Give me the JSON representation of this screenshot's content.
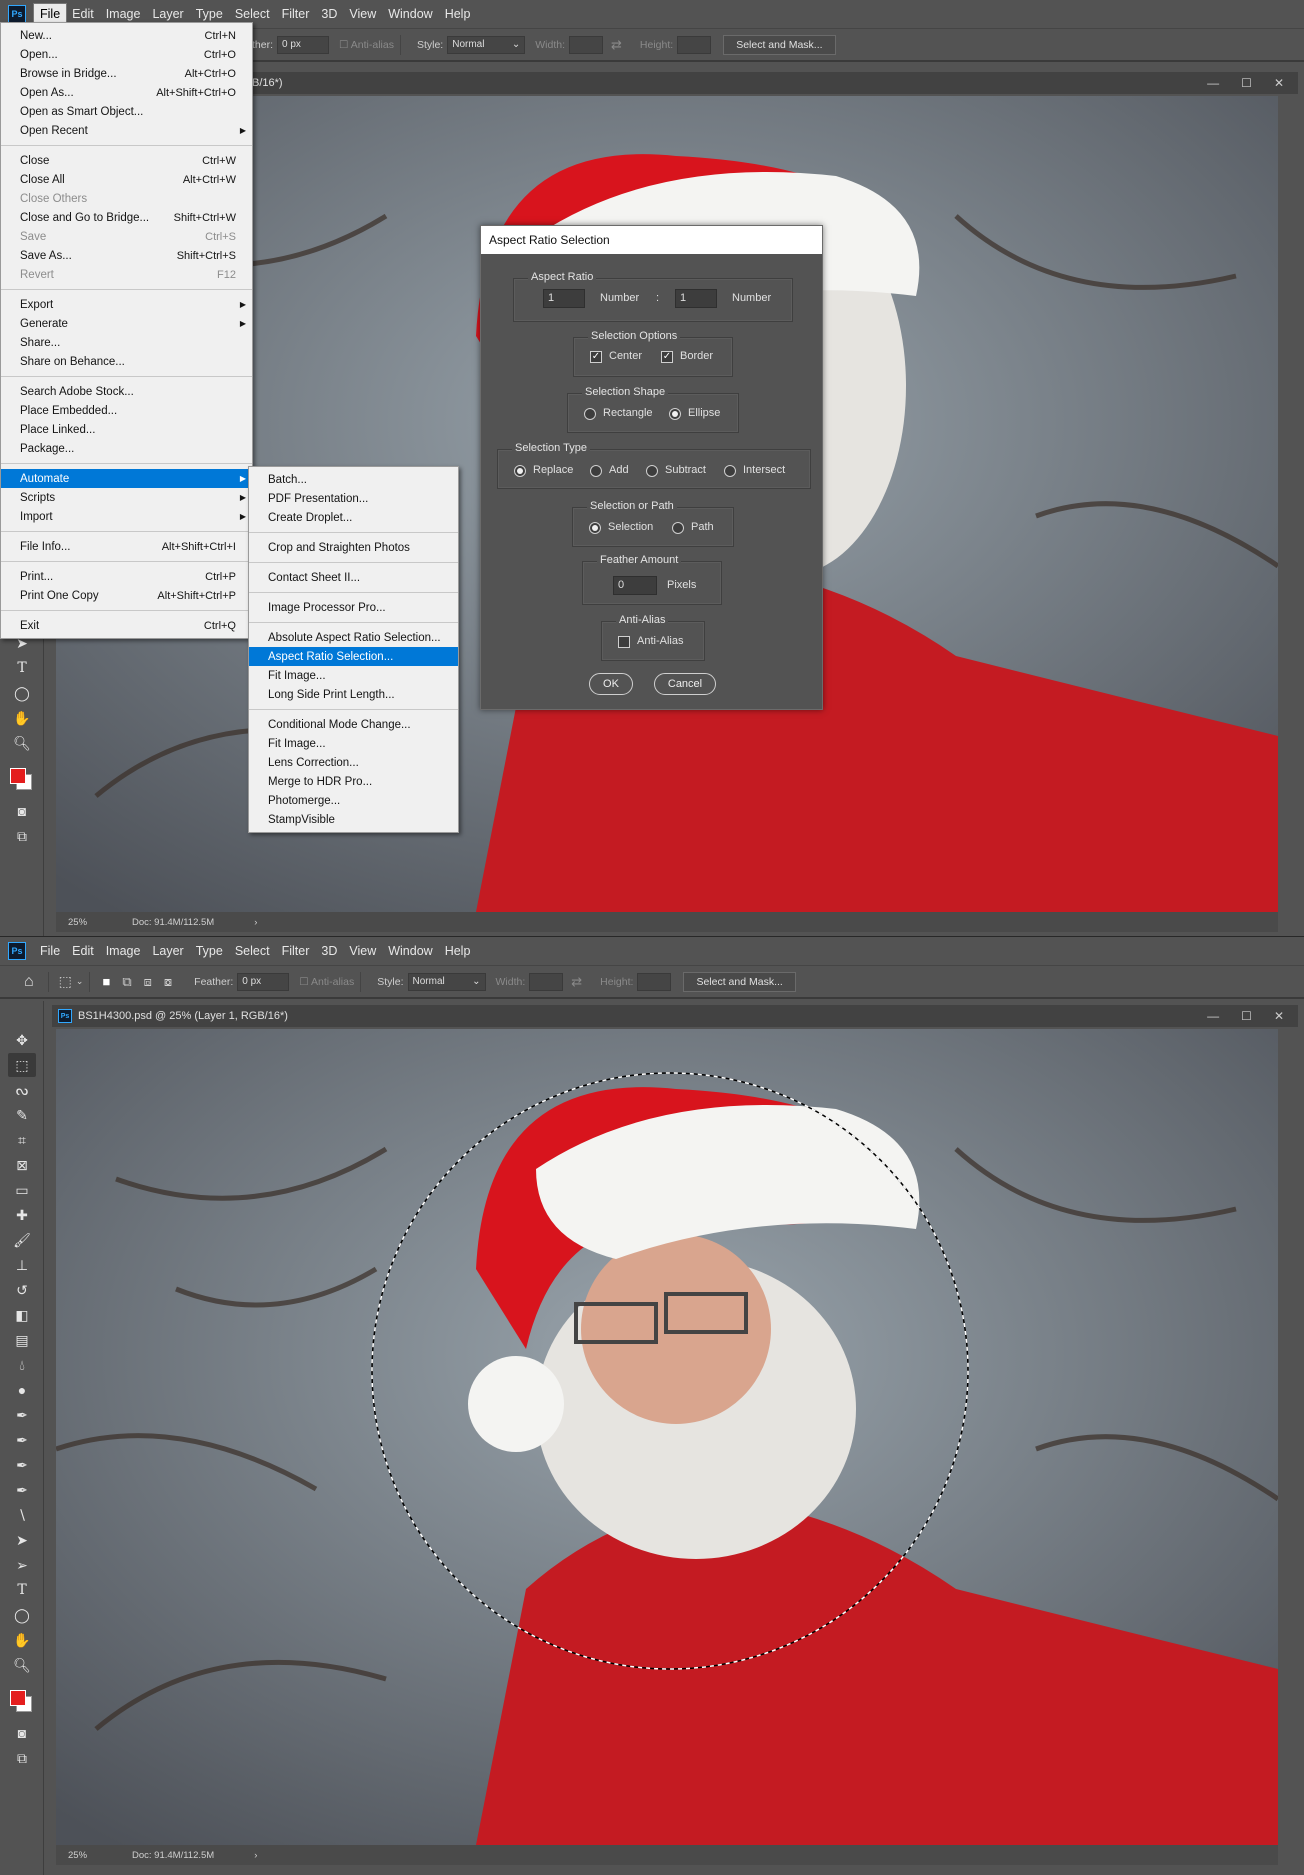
{
  "menubar": {
    "logo": "Ps",
    "items": [
      "File",
      "Edit",
      "Image",
      "Layer",
      "Type",
      "Select",
      "Filter",
      "3D",
      "View",
      "Window",
      "Help"
    ]
  },
  "options": {
    "feather_label": "Feather:",
    "feather_label_partial": "ther:",
    "feather_value": "0 px",
    "antialias": "Anti-alias",
    "style_label": "Style:",
    "style_value": "Normal",
    "width_label": "Width:",
    "height_label": "Height:",
    "select_mask": "Select and Mask..."
  },
  "doc": {
    "tab_title": "BS1H4300.psd @ 25% (Layer 1, RGB/16*)",
    "tab_title_partial": "B/16*)",
    "zoom": "25%",
    "doc_size": "Doc: 91.4M/112.5M"
  },
  "file_menu": [
    {
      "label": "New...",
      "shortcut": "Ctrl+N"
    },
    {
      "label": "Open...",
      "shortcut": "Ctrl+O"
    },
    {
      "label": "Browse in Bridge...",
      "shortcut": "Alt+Ctrl+O"
    },
    {
      "label": "Open As...",
      "shortcut": "Alt+Shift+Ctrl+O"
    },
    {
      "label": "Open as Smart Object...",
      "shortcut": ""
    },
    {
      "label": "Open Recent",
      "shortcut": "",
      "submenu": true
    },
    {
      "sep": true
    },
    {
      "label": "Close",
      "shortcut": "Ctrl+W"
    },
    {
      "label": "Close All",
      "shortcut": "Alt+Ctrl+W"
    },
    {
      "label": "Close Others",
      "shortcut": "",
      "disabled": true
    },
    {
      "label": "Close and Go to Bridge...",
      "shortcut": "Shift+Ctrl+W"
    },
    {
      "label": "Save",
      "shortcut": "Ctrl+S",
      "disabled": true
    },
    {
      "label": "Save As...",
      "shortcut": "Shift+Ctrl+S"
    },
    {
      "label": "Revert",
      "shortcut": "F12",
      "disabled": true
    },
    {
      "sep": true
    },
    {
      "label": "Export",
      "shortcut": "",
      "submenu": true
    },
    {
      "label": "Generate",
      "shortcut": "",
      "submenu": true
    },
    {
      "label": "Share...",
      "shortcut": ""
    },
    {
      "label": "Share on Behance...",
      "shortcut": ""
    },
    {
      "sep": true
    },
    {
      "label": "Search Adobe Stock...",
      "shortcut": ""
    },
    {
      "label": "Place Embedded...",
      "shortcut": ""
    },
    {
      "label": "Place Linked...",
      "shortcut": ""
    },
    {
      "label": "Package...",
      "shortcut": ""
    },
    {
      "sep": true
    },
    {
      "label": "Automate",
      "shortcut": "",
      "submenu": true,
      "highlight": true
    },
    {
      "label": "Scripts",
      "shortcut": "",
      "submenu": true
    },
    {
      "label": "Import",
      "shortcut": "",
      "submenu": true
    },
    {
      "sep": true
    },
    {
      "label": "File Info...",
      "shortcut": "Alt+Shift+Ctrl+I"
    },
    {
      "sep": true
    },
    {
      "label": "Print...",
      "shortcut": "Ctrl+P"
    },
    {
      "label": "Print One Copy",
      "shortcut": "Alt+Shift+Ctrl+P"
    },
    {
      "sep": true
    },
    {
      "label": "Exit",
      "shortcut": "Ctrl+Q"
    }
  ],
  "automate_menu": [
    {
      "label": "Batch..."
    },
    {
      "label": "PDF Presentation..."
    },
    {
      "label": "Create Droplet..."
    },
    {
      "sep": true
    },
    {
      "label": "Crop and Straighten Photos"
    },
    {
      "sep": true
    },
    {
      "label": "Contact Sheet II..."
    },
    {
      "sep": true
    },
    {
      "label": "Image Processor Pro..."
    },
    {
      "sep": true
    },
    {
      "label": "Absolute Aspect Ratio Selection..."
    },
    {
      "label": "Aspect Ratio Selection...",
      "highlight": true
    },
    {
      "label": "Fit Image..."
    },
    {
      "label": "Long Side Print Length..."
    },
    {
      "sep": true
    },
    {
      "label": "Conditional Mode Change..."
    },
    {
      "label": "Fit Image..."
    },
    {
      "label": "Lens Correction..."
    },
    {
      "label": "Merge to HDR Pro..."
    },
    {
      "label": "Photomerge..."
    },
    {
      "label": "StampVisible"
    }
  ],
  "dialog": {
    "title": "Aspect Ratio Selection",
    "aspect_ratio": {
      "title": "Aspect Ratio",
      "value1": "1",
      "unit1": "Number",
      "sep": ":",
      "value2": "1",
      "unit2": "Number"
    },
    "selection_options": {
      "title": "Selection Options",
      "center": "Center",
      "center_checked": true,
      "border": "Border",
      "border_checked": true
    },
    "selection_shape": {
      "title": "Selection Shape",
      "rectangle": "Rectangle",
      "ellipse": "Ellipse",
      "selected": "Ellipse"
    },
    "selection_type": {
      "title": "Selection Type",
      "replace": "Replace",
      "add": "Add",
      "subtract": "Subtract",
      "intersect": "Intersect",
      "selected": "Replace"
    },
    "selection_or_path": {
      "title": "Selection or Path",
      "selection": "Selection",
      "path": "Path",
      "selected": "Selection"
    },
    "feather": {
      "title": "Feather Amount",
      "value": "0",
      "unit": "Pixels"
    },
    "antialias": {
      "title": "Anti-Alias",
      "label": "Anti-Alias",
      "checked": false
    },
    "ok": "OK",
    "cancel": "Cancel"
  },
  "colors": {
    "foreground": "#e41e1e",
    "background": "#ffffff",
    "highlight": "#0078d7"
  }
}
